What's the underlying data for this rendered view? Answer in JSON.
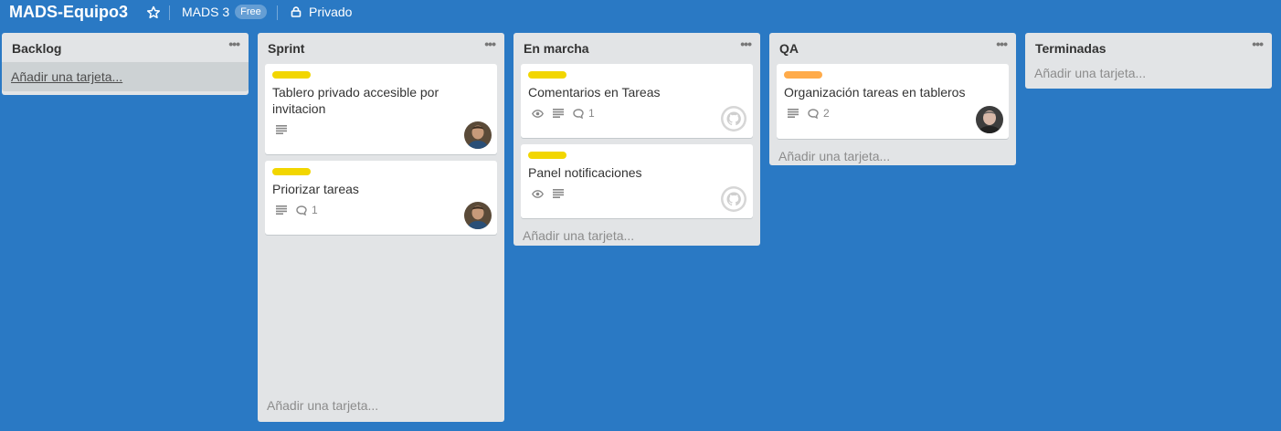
{
  "board": {
    "title": "MADS-Equipo3",
    "team_name": "MADS 3",
    "plan_badge": "Free",
    "privacy": "Privado"
  },
  "colors": {
    "background": "#2a79c4",
    "label_yellow": "#f2d600",
    "label_orange": "#ffab4a"
  },
  "lists": [
    {
      "name": "Backlog",
      "add_card": "Añadir una tarjeta...",
      "cards": []
    },
    {
      "name": "Sprint",
      "add_card": "Añadir una tarjeta...",
      "cards": [
        {
          "label_color": "yellow",
          "title": "Tablero privado accesible por invitacion",
          "badges": [
            "description-icon"
          ],
          "avatar": "member-photo"
        },
        {
          "label_color": "yellow",
          "title": "Priorizar tareas",
          "badges": [
            "description-icon",
            "comment-icon"
          ],
          "comments": "1",
          "avatar": "member-photo"
        }
      ]
    },
    {
      "name": "En marcha",
      "add_card": "Añadir una tarjeta...",
      "cards": [
        {
          "label_color": "yellow",
          "title": "Comentarios en Tareas",
          "badges": [
            "watch-icon",
            "description-icon",
            "comment-icon"
          ],
          "comments": "1",
          "avatar": "github-icon"
        },
        {
          "label_color": "yellow",
          "title": "Panel notificaciones",
          "badges": [
            "watch-icon",
            "description-icon"
          ],
          "avatar": "github-icon"
        }
      ]
    },
    {
      "name": "QA",
      "add_card": "Añadir una tarjeta...",
      "cards": [
        {
          "label_color": "orange",
          "title": "Organización tareas en tableros",
          "badges": [
            "description-icon",
            "comment-icon"
          ],
          "comments": "2",
          "avatar": "member-photo"
        }
      ]
    },
    {
      "name": "Terminadas",
      "add_card": "Añadir una tarjeta...",
      "cards": []
    }
  ],
  "list_menu_icon": "ellipsis-icon"
}
